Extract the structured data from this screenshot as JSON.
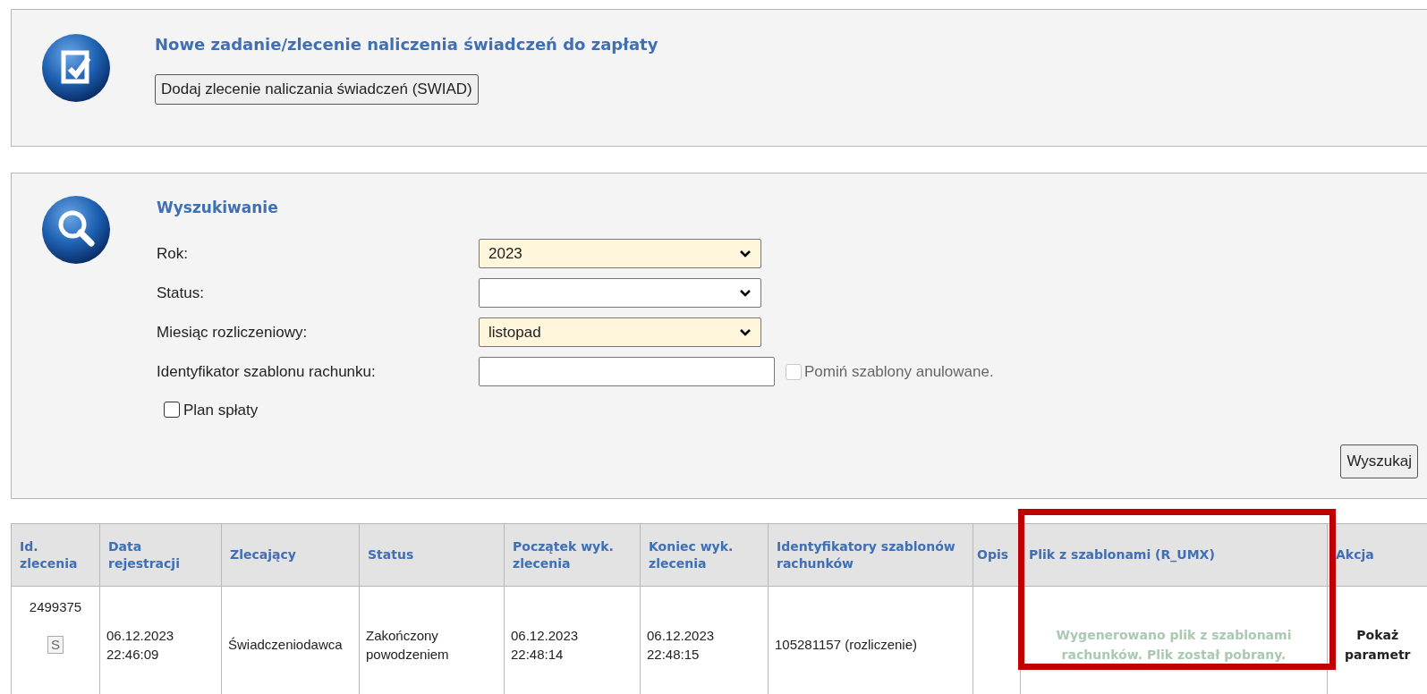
{
  "new_task": {
    "title": "Nowe zadanie/zlecenie naliczenia świadczeń do zapłaty",
    "button": "Dodaj zlecenie naliczania świadczeń (SWIAD)"
  },
  "search": {
    "title": "Wyszukiwanie",
    "fields": [
      {
        "kind": "select",
        "label": "Rok:",
        "value": "2023",
        "filled": true
      },
      {
        "kind": "select",
        "label": "Status:",
        "filled": false
      },
      {
        "kind": "select",
        "label": "Miesiąc rozliczeniowy:",
        "value": "listopad",
        "filled": true
      },
      {
        "kind": "text",
        "label": "Identyfikator szablonu rachunku:",
        "option": {
          "label": "Pomiń szablony anulowane.",
          "checked": false,
          "disabled": true
        }
      }
    ],
    "plan": {
      "label": "Plan spłaty",
      "checked": false
    },
    "button": "Wyszukaj"
  },
  "table": {
    "columns": [
      {
        "label": "Id. zlecenia",
        "highlighted": false
      },
      {
        "label": "Data rejestracji",
        "highlighted": false
      },
      {
        "label": "Zlecający",
        "highlighted": false
      },
      {
        "label": "Status",
        "highlighted": false
      },
      {
        "label": "Początek wyk. zlecenia",
        "highlighted": false
      },
      {
        "label": "Koniec wyk. zlecenia",
        "highlighted": false
      },
      {
        "label": "Identyfikatory szablonów rachunków",
        "highlighted": false
      },
      {
        "label": "Opis",
        "highlighted": false
      },
      {
        "label": "Plik z szablonami (R_UMX)",
        "highlighted": true
      },
      {
        "label": "Akcja",
        "highlighted": false
      }
    ],
    "rows": [
      {
        "id": "2499375",
        "badge": "S",
        "registered": "06.12.2023 22:46:09",
        "ordered_by": "Świadczeniodawca",
        "status": "Zakończony powodzeniem",
        "start": "06.12.2023 22:48:14",
        "end": "06.12.2023 22:48:15",
        "template_ids": "105281157 (rozliczenie)",
        "file": "Wygenerowano plik z szablonami rachunków. Plik został pobrany.",
        "action": "Pokaż parametr"
      }
    ]
  }
}
